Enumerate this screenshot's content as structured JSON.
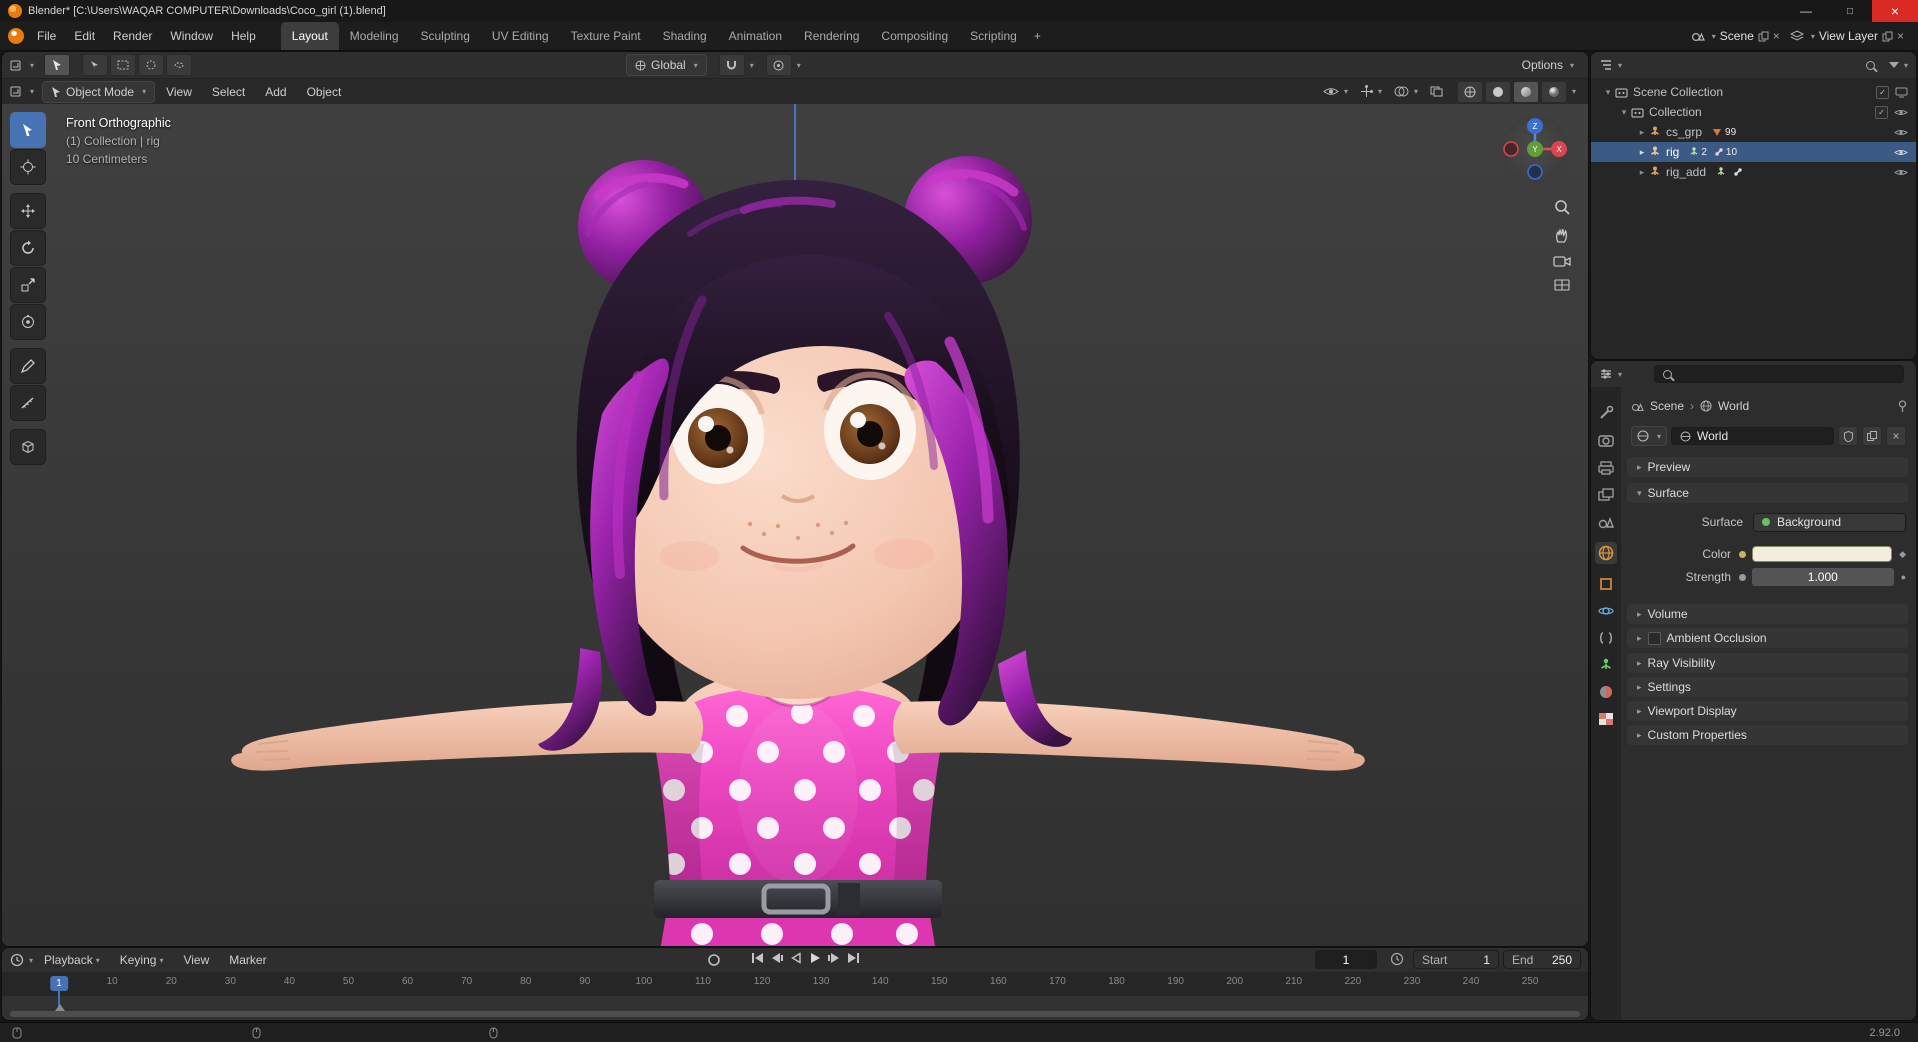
{
  "window": {
    "title": "Blender* [C:\\Users\\WAQAR COMPUTER\\Downloads\\Coco_girl (1).blend]",
    "minimize_icon": "—",
    "maximize_icon": "□",
    "close_icon": "×"
  },
  "topbar": {
    "menus": [
      "File",
      "Edit",
      "Render",
      "Window",
      "Help"
    ],
    "workspaces": [
      "Layout",
      "Modeling",
      "Sculpting",
      "UV Editing",
      "Texture Paint",
      "Shading",
      "Animation",
      "Rendering",
      "Compositing",
      "Scripting"
    ],
    "add_workspace": "+",
    "scene": "Scene",
    "view_layer": "View Layer"
  },
  "tool_settings": {
    "orientation": "Global",
    "options": "Options"
  },
  "viewport": {
    "mode": "Object Mode",
    "menus": [
      "View",
      "Select",
      "Add",
      "Object"
    ],
    "overlay": [
      "Front Orthographic",
      "(1) Collection | rig",
      "10 Centimeters"
    ],
    "axis_z": "Z",
    "axis_y": "Y",
    "axis_x": "X"
  },
  "outliner": {
    "rows": [
      {
        "name": "Scene Collection"
      },
      {
        "name": "Collection"
      },
      {
        "name": "cs_grp",
        "count": "99"
      },
      {
        "name": "rig",
        "count_a": "2",
        "count_b": "10"
      },
      {
        "name": "rig_add"
      }
    ]
  },
  "properties": {
    "breadcrumb_scene": "Scene",
    "breadcrumb_world": "World",
    "datablock": "World",
    "panels": {
      "preview": "Preview",
      "surface": "Surface",
      "volume": "Volume",
      "ambient_occlusion": "Ambient Occlusion",
      "ray_visibility": "Ray Visibility",
      "settings": "Settings",
      "viewport_display": "Viewport Display",
      "custom_properties": "Custom Properties"
    },
    "surface": {
      "surface_label": "Surface",
      "surface_value": "Background",
      "color_label": "Color",
      "strength_label": "Strength",
      "strength_value": "1.000"
    }
  },
  "timeline": {
    "menus": [
      "Playback",
      "Keying",
      "View",
      "Marker"
    ],
    "current_frame": "1",
    "start_label": "Start",
    "start_value": "1",
    "end_label": "End",
    "end_value": "250",
    "ruler_frames": [
      10,
      20,
      30,
      40,
      50,
      60,
      70,
      80,
      90,
      100,
      110,
      120,
      130,
      140,
      150,
      160,
      170,
      180,
      190,
      200,
      210,
      220,
      230,
      240,
      250
    ]
  },
  "statusbar": {
    "version": "2.92.0"
  }
}
